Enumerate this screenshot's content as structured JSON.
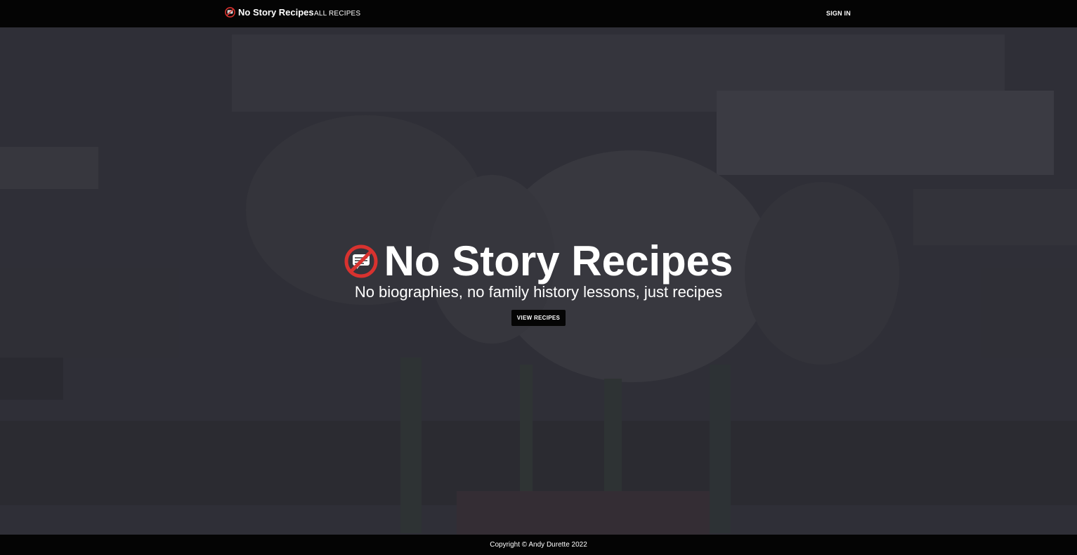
{
  "nav": {
    "brand_label": "No Story Recipes",
    "brand_icon": "no-story-icon",
    "all_recipes_label": "ALL RECIPES",
    "sign_in_label": "SIGN IN"
  },
  "hero": {
    "title": "No Story Recipes",
    "subtitle": "No biographies, no family history lessons, just recipes",
    "button_label": "VIEW RECIPES",
    "background_image": "cake-pops-photo"
  },
  "footer": {
    "copyright": "Copyright © Andy Durette 2022"
  },
  "colors": {
    "navbar": "#040404",
    "logo_red": "#d8322f",
    "hero_tint": "#34343b",
    "text": "#ffffff"
  }
}
